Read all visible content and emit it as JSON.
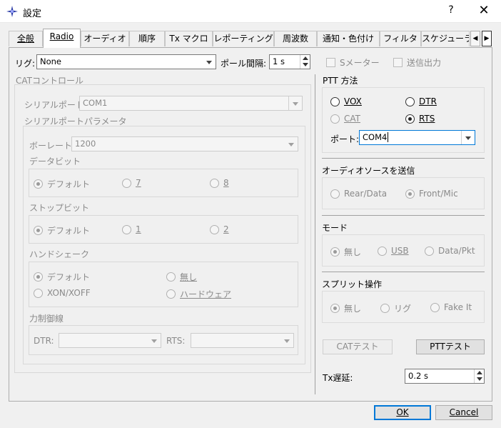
{
  "window": {
    "title": "設定",
    "help": "?",
    "close": "✕"
  },
  "tabs": [
    {
      "label": "全般",
      "active": false
    },
    {
      "label": "Radio",
      "active": true
    },
    {
      "label": "オーディオ",
      "active": false
    },
    {
      "label": "順序",
      "active": false
    },
    {
      "label": "Tx マクロ",
      "active": false
    },
    {
      "label": "レポーティング",
      "active": false
    },
    {
      "label": "周波数",
      "active": false
    },
    {
      "label": "通知・色付け",
      "active": false
    },
    {
      "label": "フィルタ",
      "active": false
    },
    {
      "label": "スケジューラ",
      "active": false
    }
  ],
  "top": {
    "rig_label": "リグ:",
    "rig_value": "None",
    "poll_label": "ポール間隔:",
    "poll_value": "1 s",
    "smeter_label": "Sメーター",
    "txout_label": "送信出力"
  },
  "cat": {
    "title": "CATコントロール",
    "serial_port_label": "シリアルポート:",
    "serial_port_value": "COM1",
    "params_title": "シリアルポートパラメータ",
    "baud_label": "ボーレート:",
    "baud_value": "1200",
    "databits_title": "データビット",
    "databits": [
      "デフォルト",
      "7",
      "8"
    ],
    "stopbits_title": "ストップビット",
    "stopbits": [
      "デフォルト",
      "1",
      "2"
    ],
    "handshake_title": "ハンドシェーク",
    "handshake": [
      "デフォルト",
      "無し",
      "XON/XOFF",
      "ハードウェア"
    ],
    "force_title": "力制御線",
    "dtr_label": "DTR:",
    "rts_label": "RTS:"
  },
  "ptt": {
    "title": "PTT 方法",
    "options": [
      "VOX",
      "DTR",
      "CAT",
      "RTS"
    ],
    "selected": "RTS",
    "port_label": "ポート:",
    "port_value": "COM4"
  },
  "audio": {
    "title": "オーディオソースを送信",
    "options": [
      "Rear/Data",
      "Front/Mic"
    ],
    "selected": "Front/Mic"
  },
  "mode": {
    "title": "モード",
    "options": [
      "無し",
      "USB",
      "Data/Pkt"
    ],
    "selected": "無し"
  },
  "split": {
    "title": "スプリット操作",
    "options": [
      "無し",
      "リグ",
      "Fake It"
    ],
    "selected": "無し"
  },
  "buttons": {
    "cat_test": "CATテスト",
    "ptt_test": "PTTテスト",
    "ok": "OK",
    "cancel": "Cancel"
  },
  "tx_delay": {
    "label": "Tx遅延:",
    "value": "0.2 s"
  }
}
